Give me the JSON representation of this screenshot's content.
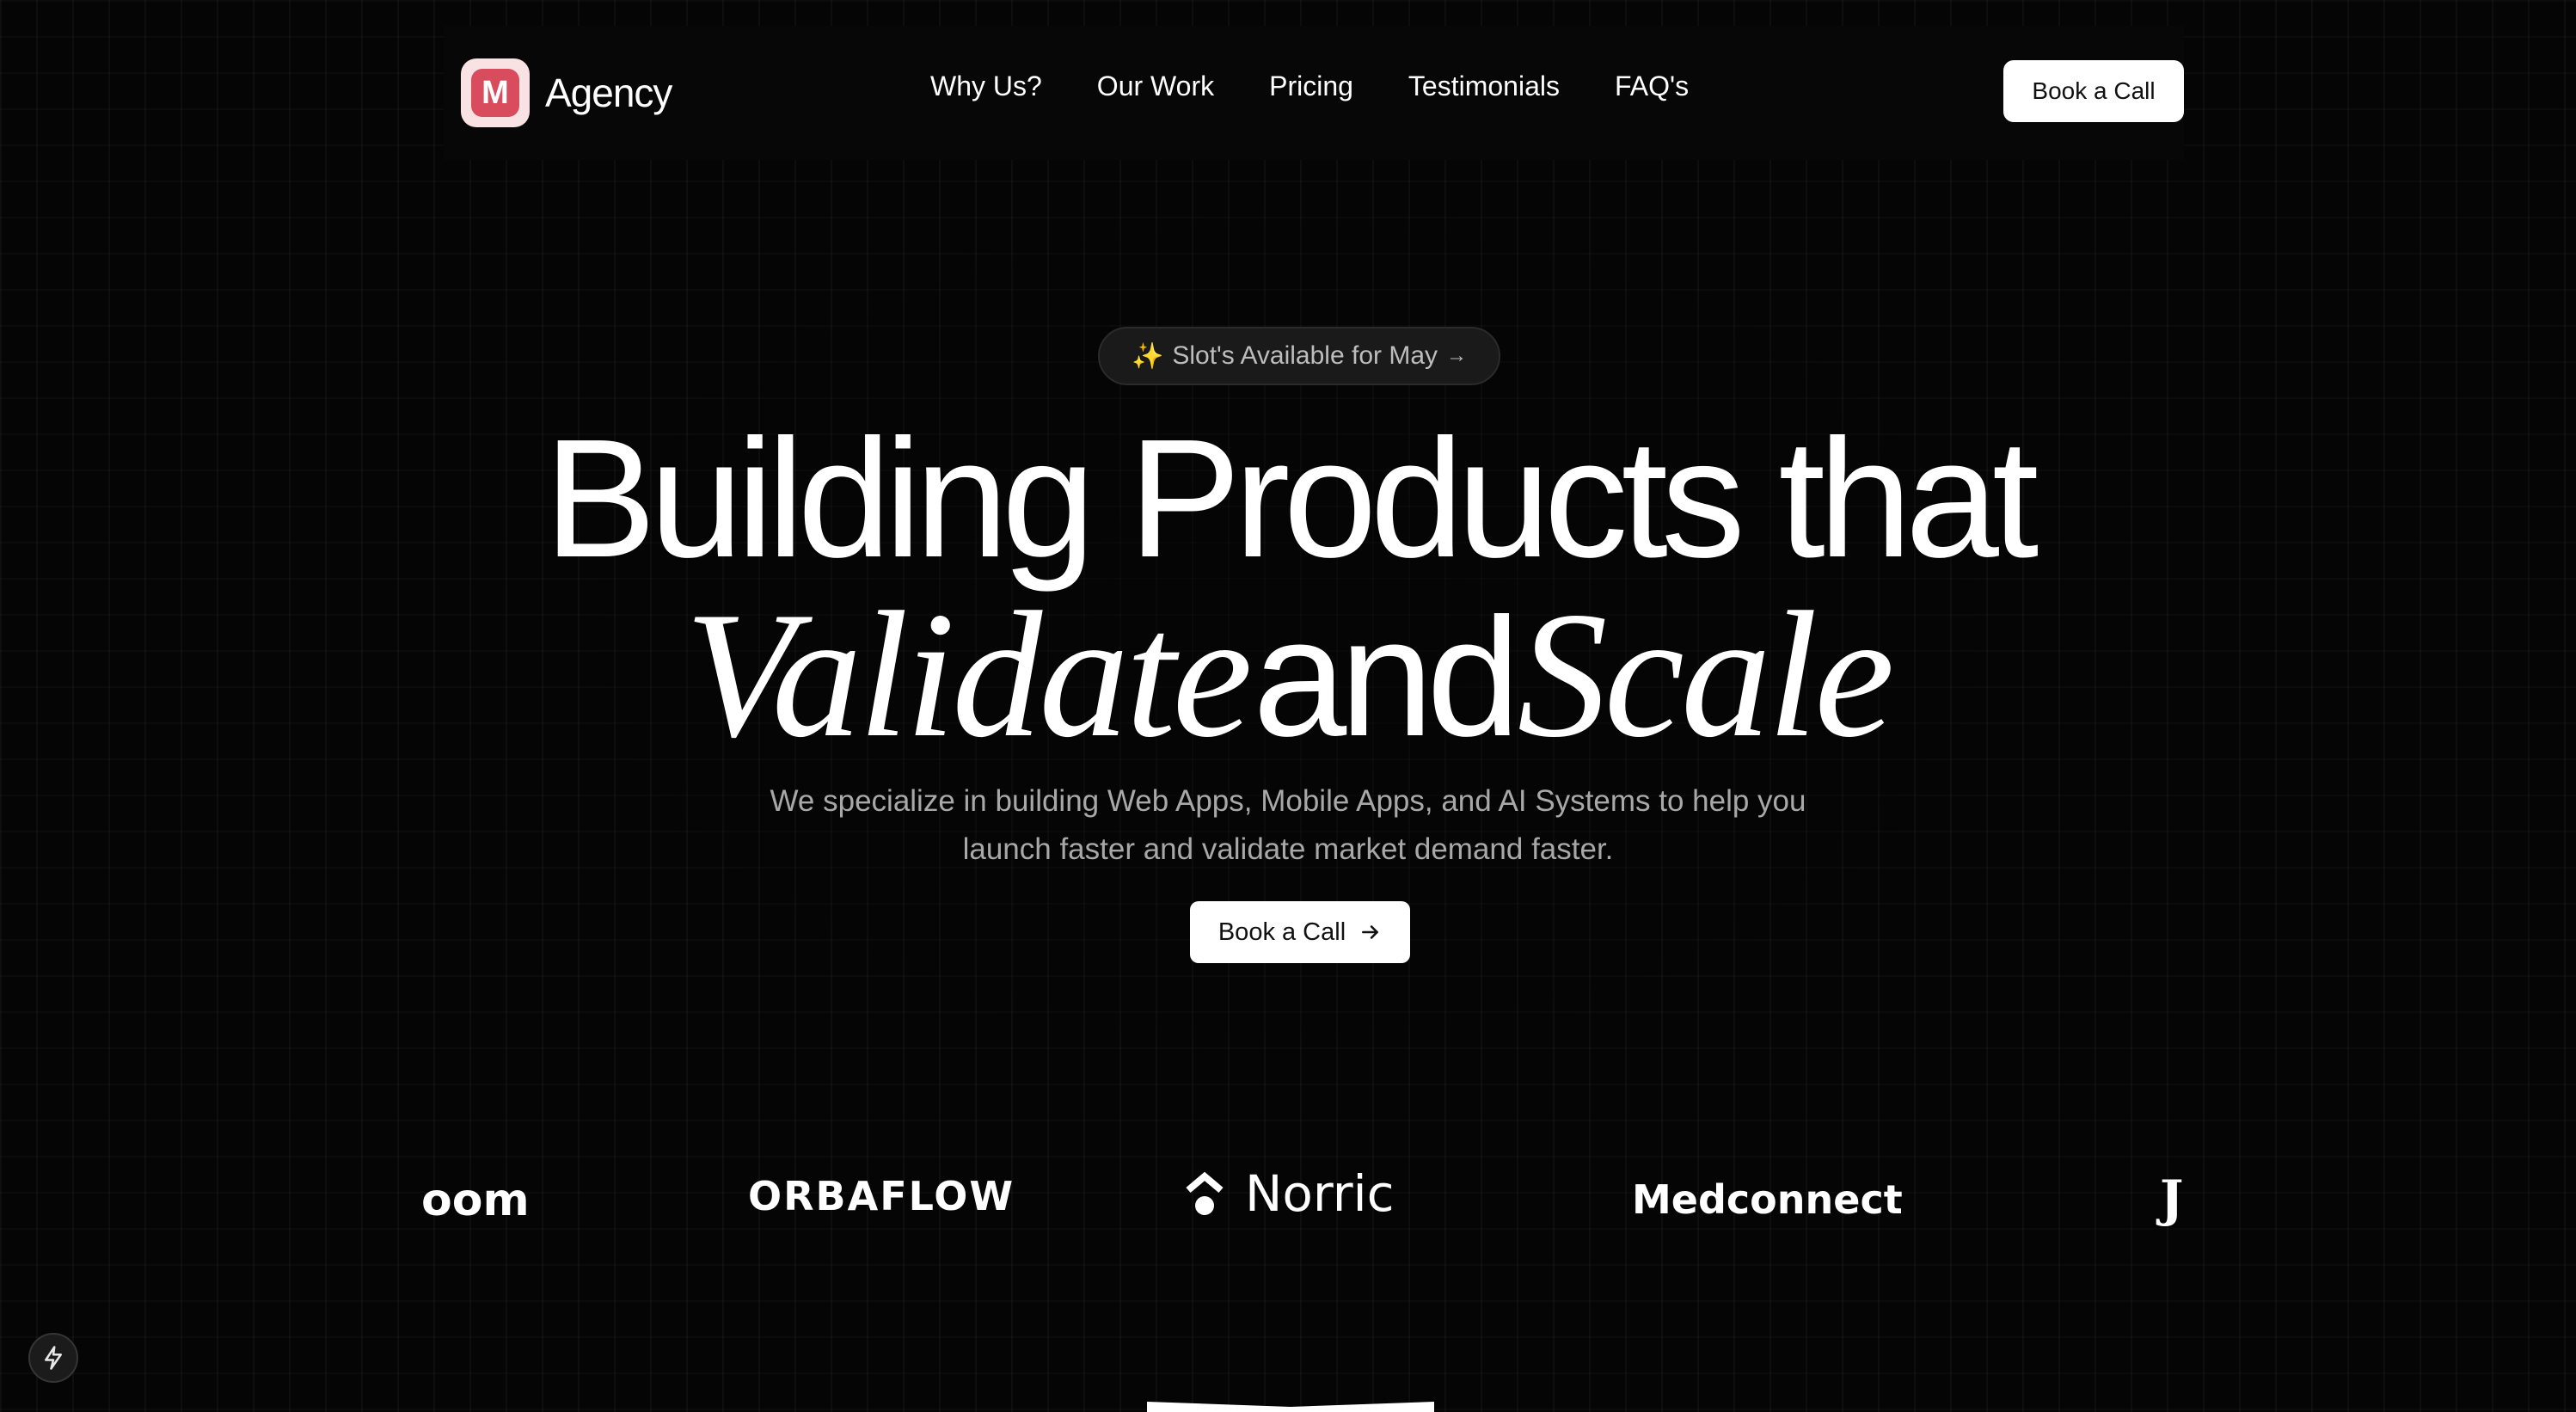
{
  "nav": {
    "brand_name": "Agency",
    "brand_logo_letter": "M",
    "links": [
      {
        "label": "Why Us?"
      },
      {
        "label": "Our Work"
      },
      {
        "label": "Pricing"
      },
      {
        "label": "Testimonials"
      },
      {
        "label": "FAQ's"
      }
    ],
    "cta_label": "Book a Call"
  },
  "hero": {
    "badge_icon": "sparkles-icon",
    "badge_text": "Slot's Available for May",
    "headline_line1": "Building Products that",
    "headline_word_validate": "Validate",
    "headline_word_and": "and",
    "headline_word_scale": "Scale",
    "subtext": "We specialize in building Web Apps, Mobile Apps, and AI Systems to help you launch faster and validate market demand faster.",
    "cta_label": "Book a Call",
    "cta_icon": "arrow-right-icon"
  },
  "client_logos": [
    {
      "name": "oom"
    },
    {
      "name": "ORBAFLOW"
    },
    {
      "name": "Norric"
    },
    {
      "name": "Medconnect"
    },
    {
      "name": "J"
    }
  ],
  "colors": {
    "background": "#050505",
    "brand_accent": "#d94c5d",
    "brand_accent_light": "#f9e2e4",
    "button_bg": "#ffffff"
  }
}
